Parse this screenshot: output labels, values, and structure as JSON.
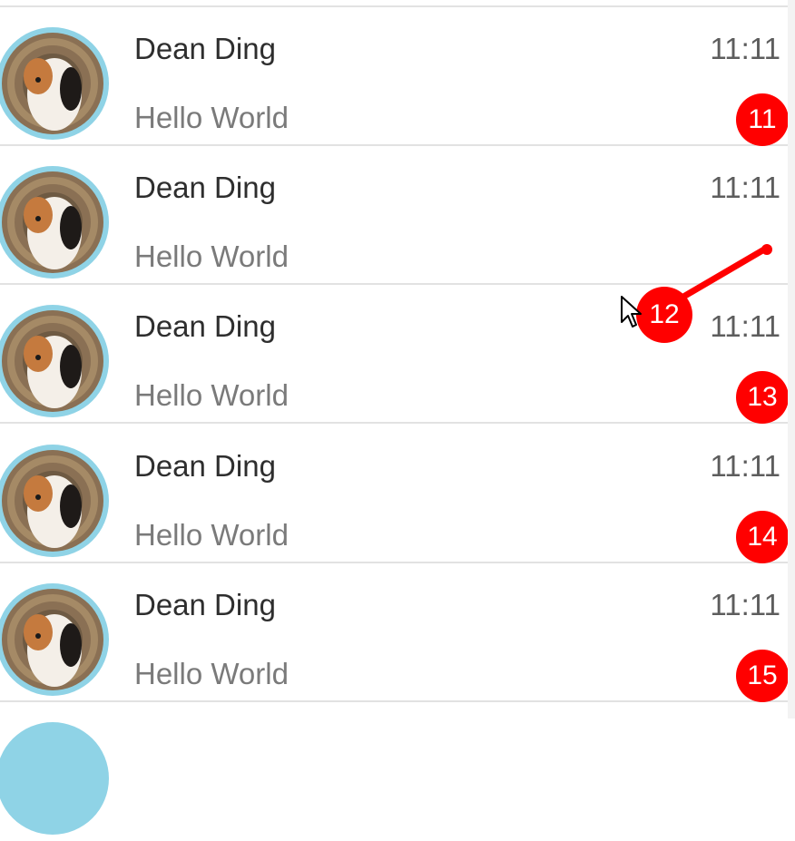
{
  "messages": [
    {
      "name": "Dean Ding",
      "preview": "Hello World",
      "time": "11:11",
      "unread": "11"
    },
    {
      "name": "Dean Ding",
      "preview": "Hello World",
      "time": "11:11",
      "unread": ""
    },
    {
      "name": "Dean Ding",
      "preview": "Hello World",
      "time": "11:11",
      "unread": "13"
    },
    {
      "name": "Dean Ding",
      "preview": "Hello World",
      "time": "11:11",
      "unread": "14"
    },
    {
      "name": "Dean Ding",
      "preview": "Hello World",
      "time": "11:11",
      "unread": "15"
    }
  ],
  "dragged_badge": {
    "count": "12"
  },
  "colors": {
    "badge": "#ff0000",
    "avatar_ring": "#8fd3e6"
  },
  "icons": {
    "avatar": "guinea-pig-avatar",
    "cursor": "mouse-pointer-icon"
  }
}
